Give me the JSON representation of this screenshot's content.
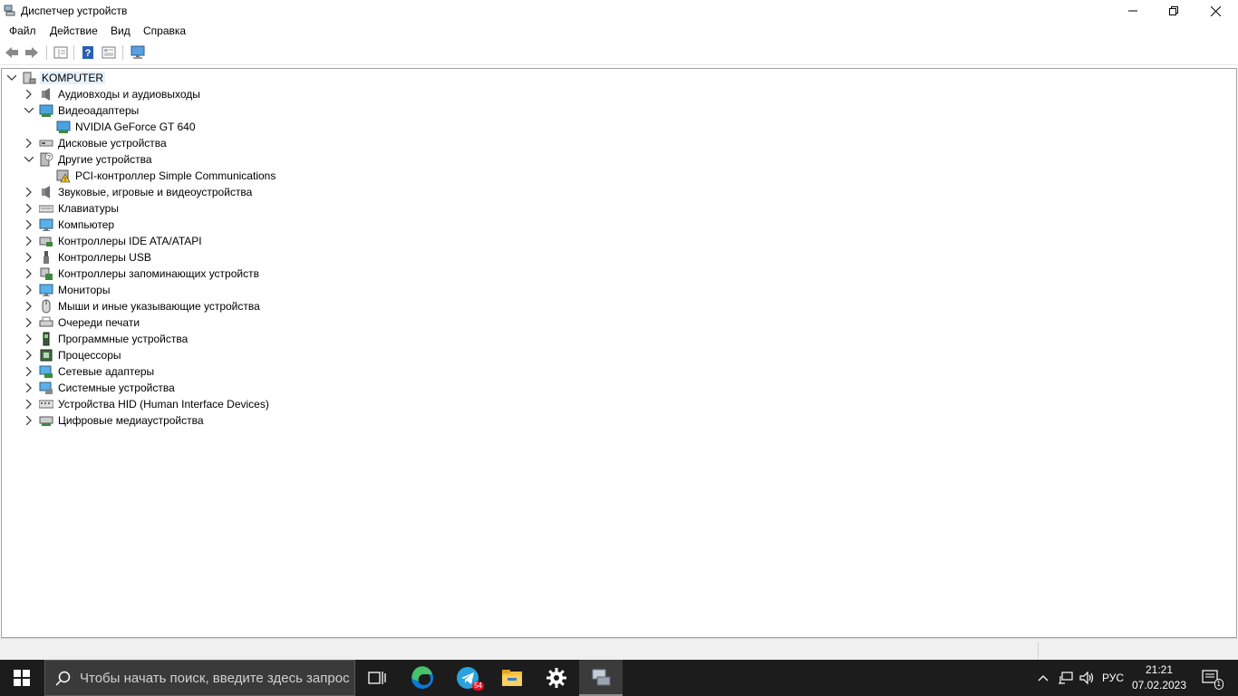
{
  "window": {
    "title": "Диспетчер устройств"
  },
  "menu": [
    "Файл",
    "Действие",
    "Вид",
    "Справка"
  ],
  "tree": {
    "root": "KOMPUTER",
    "categories": [
      {
        "label": "Аудиовходы и аудиовыходы",
        "icon": "speaker-icon",
        "expanded": false,
        "children": []
      },
      {
        "label": "Видеоадаптеры",
        "icon": "display-adapter-icon",
        "expanded": true,
        "children": [
          {
            "label": "NVIDIA GeForce GT 640",
            "icon": "display-adapter-icon"
          }
        ]
      },
      {
        "label": "Дисковые устройства",
        "icon": "disk-drive-icon",
        "expanded": false,
        "children": []
      },
      {
        "label": "Другие устройства",
        "icon": "unknown-device-icon",
        "expanded": true,
        "children": [
          {
            "label": "PCI-контроллер Simple Communications",
            "icon": "warning-device-icon"
          }
        ]
      },
      {
        "label": "Звуковые, игровые и видеоустройства",
        "icon": "speaker-icon",
        "expanded": false,
        "children": []
      },
      {
        "label": "Клавиатуры",
        "icon": "keyboard-icon",
        "expanded": false,
        "children": []
      },
      {
        "label": "Компьютер",
        "icon": "monitor-icon",
        "expanded": false,
        "children": []
      },
      {
        "label": "Контроллеры IDE ATA/ATAPI",
        "icon": "ide-controller-icon",
        "expanded": false,
        "children": []
      },
      {
        "label": "Контроллеры USB",
        "icon": "usb-icon",
        "expanded": false,
        "children": []
      },
      {
        "label": "Контроллеры запоминающих устройств",
        "icon": "storage-controller-icon",
        "expanded": false,
        "children": []
      },
      {
        "label": "Мониторы",
        "icon": "monitor-icon",
        "expanded": false,
        "children": []
      },
      {
        "label": "Мыши и иные указывающие устройства",
        "icon": "mouse-icon",
        "expanded": false,
        "children": []
      },
      {
        "label": "Очереди печати",
        "icon": "printer-icon",
        "expanded": false,
        "children": []
      },
      {
        "label": "Программные устройства",
        "icon": "software-device-icon",
        "expanded": false,
        "children": []
      },
      {
        "label": "Процессоры",
        "icon": "processor-icon",
        "expanded": false,
        "children": []
      },
      {
        "label": "Сетевые адаптеры",
        "icon": "network-adapter-icon",
        "expanded": false,
        "children": []
      },
      {
        "label": "Системные устройства",
        "icon": "system-device-icon",
        "expanded": false,
        "children": []
      },
      {
        "label": "Устройства HID (Human Interface Devices)",
        "icon": "hid-icon",
        "expanded": false,
        "children": []
      },
      {
        "label": "Цифровые медиаустройства",
        "icon": "media-device-icon",
        "expanded": false,
        "children": []
      }
    ]
  },
  "taskbar": {
    "search_placeholder": "Чтобы начать поиск, введите здесь запрос",
    "telegram_badge": "54",
    "language": "РУС",
    "time": "21:21",
    "date": "07.02.2023",
    "notification_count": "1"
  },
  "colors": {
    "selection": "#e5f1fb",
    "taskbar": "#1c1c1c",
    "accent": "#0078d7"
  }
}
